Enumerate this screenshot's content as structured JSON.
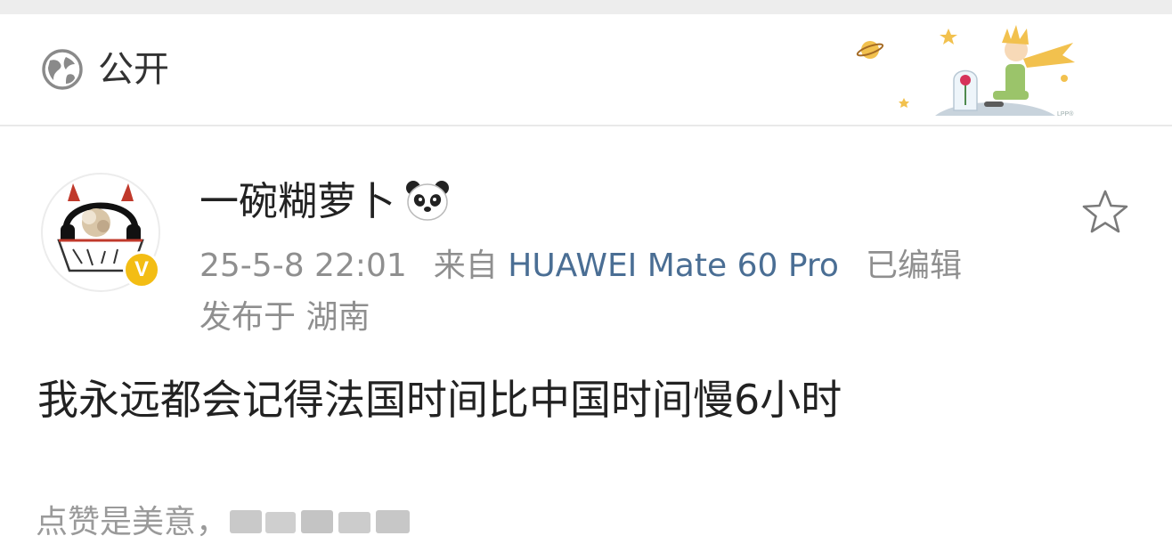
{
  "visibility": {
    "icon": "globe-icon",
    "label": "公开"
  },
  "banner": {
    "description_icon": "little-prince-banner",
    "corner_mark": "LPP®"
  },
  "post": {
    "author": {
      "name": "一碗糊萝卜",
      "name_emoji_icon": "panda-icon",
      "verified_badge": "V",
      "badge_color": "#f3bd14"
    },
    "timestamp": "25-5-8 22:01",
    "source_prefix": "来自",
    "source_device": "HUAWEI Mate 60 Pro",
    "edited_label": "已编辑",
    "location": "发布于 湖南",
    "content": "我永远都会记得法国时间比中国时间慢6小时",
    "favorite_icon": "star-outline-icon",
    "like_prompt": "点赞是美意，",
    "like_prompt_obscured_icon": "obscured-text"
  },
  "colors": {
    "device_link": "#4a6e94",
    "meta_gray": "#8f8f8f",
    "text_dark": "#222222"
  }
}
